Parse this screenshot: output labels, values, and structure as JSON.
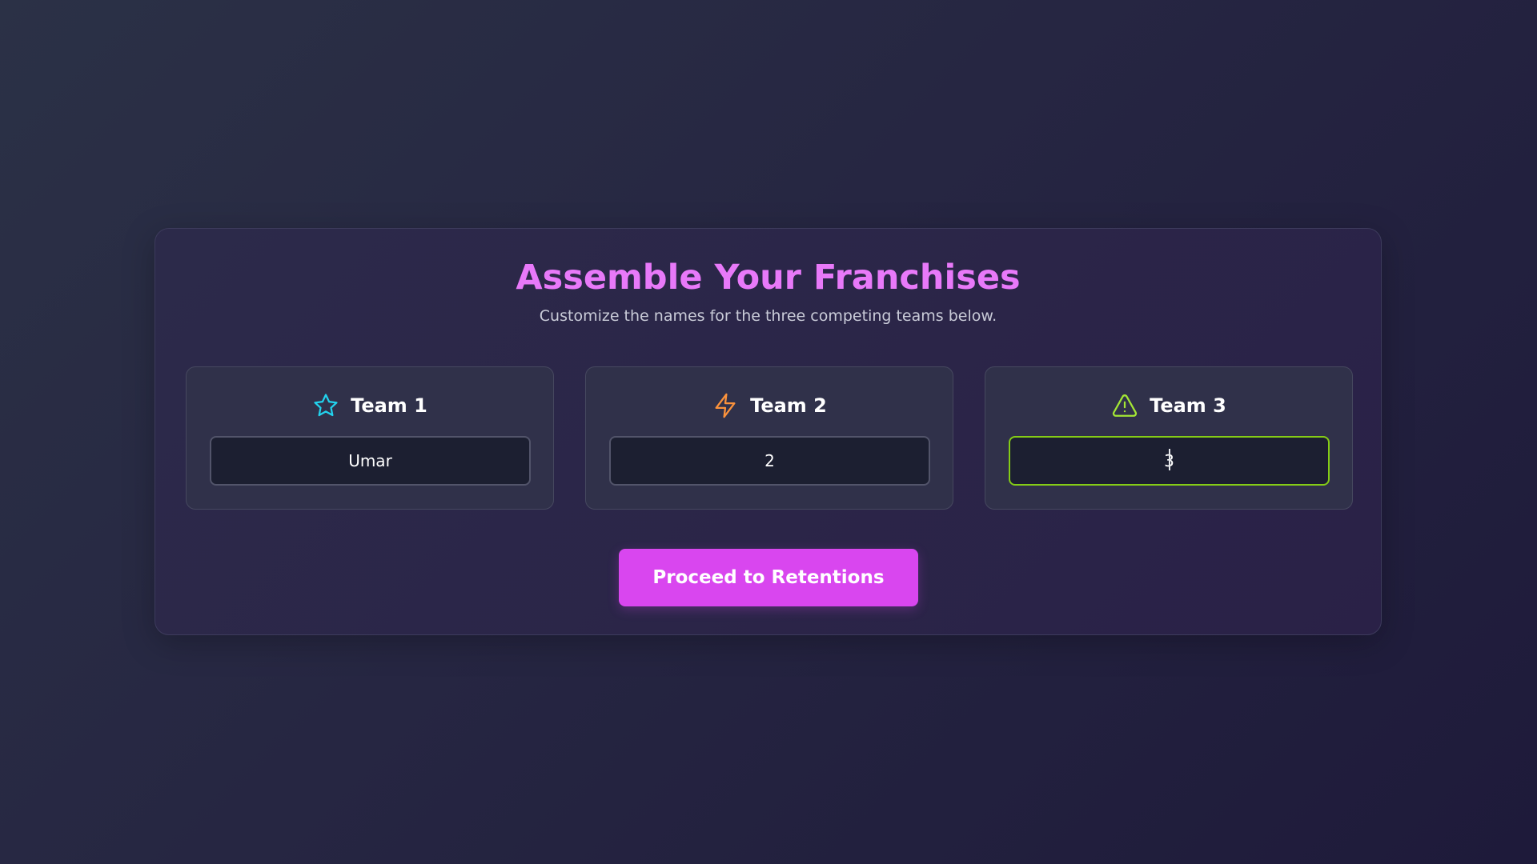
{
  "header": {
    "title": "Assemble Your Franchises",
    "subtitle": "Customize the names for the three competing teams below."
  },
  "teams": [
    {
      "label": "Team 1",
      "icon": "star-icon",
      "icon_color": "#22d3ee",
      "value": "Umar"
    },
    {
      "label": "Team 2",
      "icon": "lightning-icon",
      "icon_color": "#fb923c",
      "value": "2"
    },
    {
      "label": "Team 3",
      "icon": "warning-triangle-icon",
      "icon_color": "#a3e635",
      "value": "3",
      "focused": true
    }
  ],
  "actions": {
    "proceed_label": "Proceed to Retentions"
  },
  "colors": {
    "title": "#e879f9",
    "button": "#d946ef",
    "focus_border": "#84cc16"
  }
}
